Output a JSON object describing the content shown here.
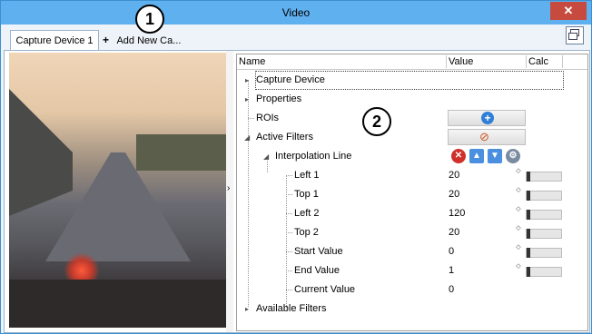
{
  "window": {
    "title": "Video",
    "close_glyph": "✕"
  },
  "callouts": {
    "one": "1",
    "two": "2"
  },
  "tabs": {
    "active_label": "Capture Device 1",
    "add_label": "Add New Ca...",
    "add_icon": "plus-icon",
    "layout_icon": "window-layout-icon"
  },
  "splitter": {
    "glyph": "›"
  },
  "grid": {
    "columns": [
      "Name",
      "Value",
      "Calc"
    ],
    "rows": [
      {
        "name": "Capture Device",
        "value": ""
      },
      {
        "name": "Properties",
        "value": ""
      },
      {
        "name": "ROIs",
        "value": ""
      },
      {
        "name": "Active Filters",
        "value": ""
      },
      {
        "name": "Interpolation Line",
        "value": ""
      },
      {
        "name": "Left 1",
        "value": "20"
      },
      {
        "name": "Top 1",
        "value": "20"
      },
      {
        "name": "Left 2",
        "value": "120"
      },
      {
        "name": "Top 2",
        "value": "20"
      },
      {
        "name": "Start Value",
        "value": "0"
      },
      {
        "name": "End Value",
        "value": "1"
      },
      {
        "name": "Current Value",
        "value": "0"
      },
      {
        "name": "Available Filters",
        "value": ""
      }
    ],
    "icons": {
      "rois_button": "add-circle-icon",
      "active_filters_button": "eye-hidden-icon",
      "interp_buttons": [
        "remove-icon",
        "arrow-up-icon",
        "arrow-down-icon",
        "settings-icon"
      ]
    },
    "glyphs": {
      "expand": "▸",
      "collapse": "◢",
      "plus": "+",
      "eye": "⊘",
      "remove": "✕",
      "up": "▲",
      "down": "▼",
      "gear": "⚙",
      "spin": "◇"
    }
  }
}
